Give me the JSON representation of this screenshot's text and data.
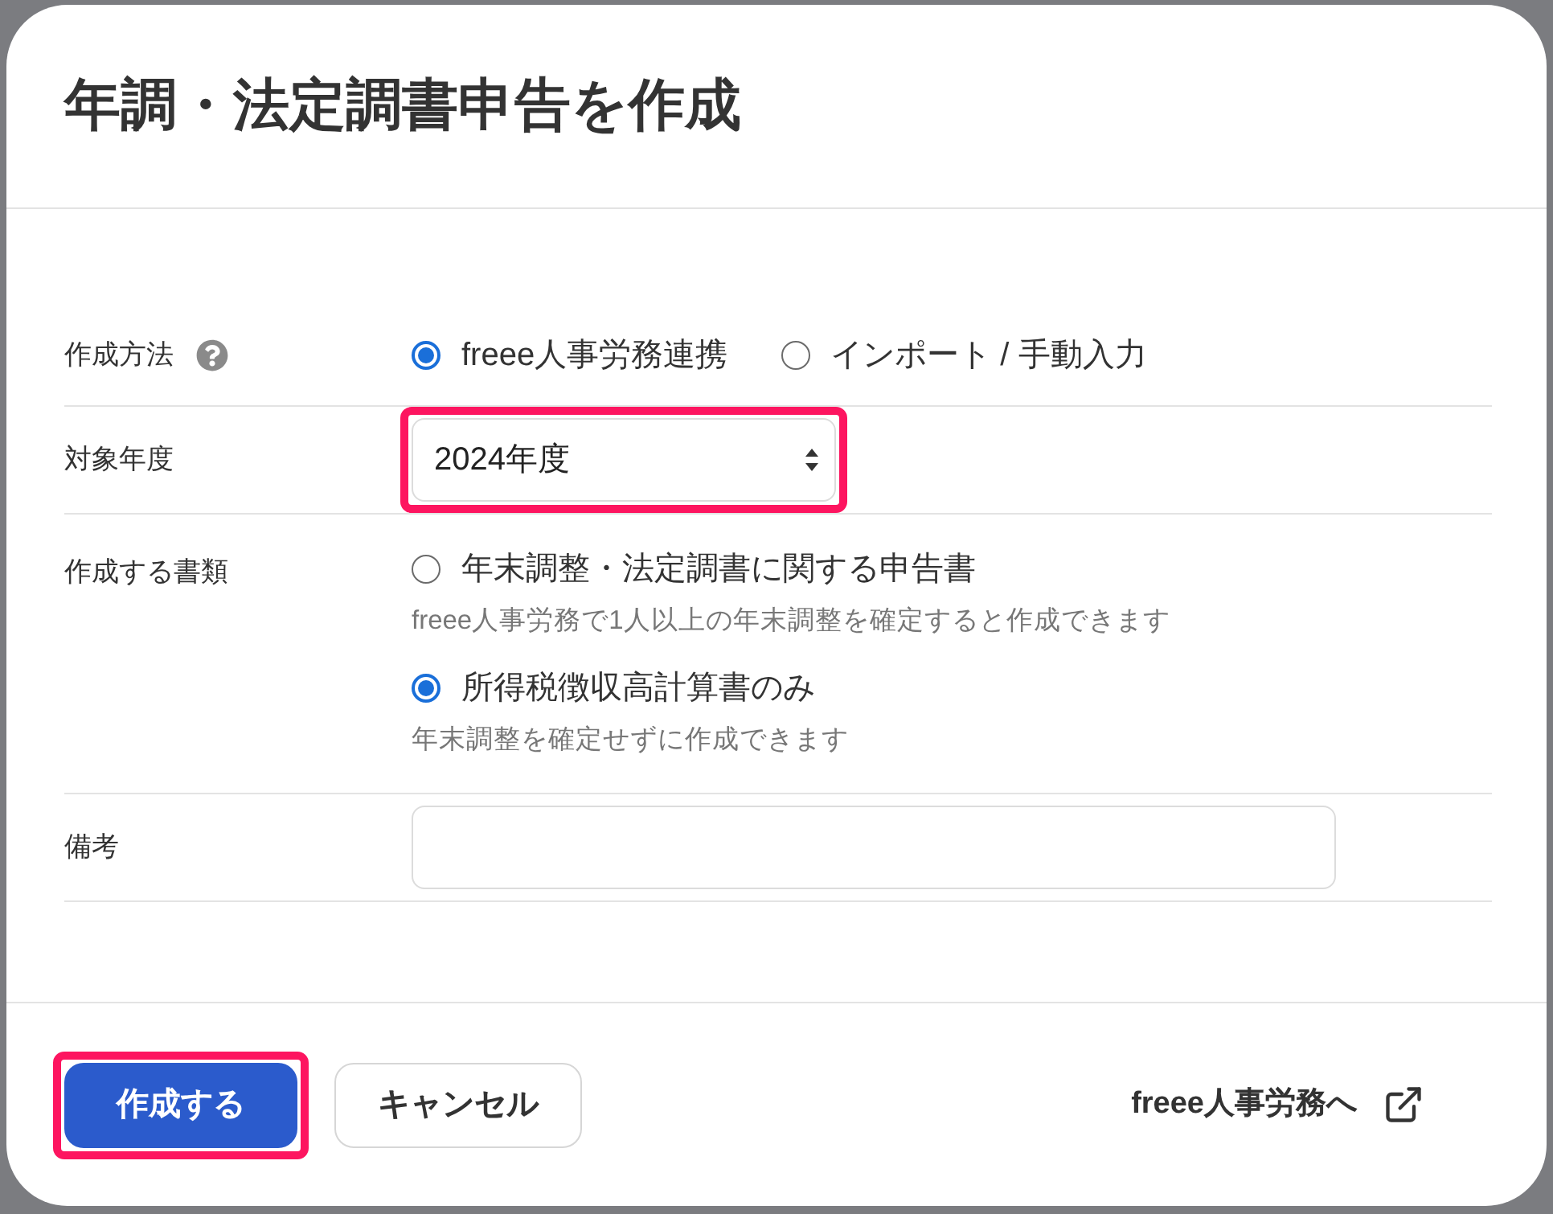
{
  "dialog": {
    "title": "年調・法定調書申告を作成",
    "fields": [
      {
        "kind": "radio_row",
        "label": "作成方法",
        "help": true,
        "options": [
          {
            "label": "freee人事労務連携",
            "selected": true
          },
          {
            "label": "インポート / 手動入力",
            "selected": false
          }
        ]
      },
      {
        "kind": "select",
        "label": "対象年度",
        "value": "2024年度",
        "highlighted": true
      },
      {
        "kind": "radio_list",
        "label": "作成する書類",
        "options": [
          {
            "label": "年末調整・法定調書に関する申告書",
            "note": "freee人事労務で1人以上の年末調整を確定すると作成できます",
            "selected": false
          },
          {
            "label": "所得税徴収高計算書のみ",
            "note": "年末調整を確定せずに作成できます",
            "selected": true
          }
        ]
      },
      {
        "kind": "text_input",
        "label": "備考"
      }
    ],
    "footer": {
      "buttons": [
        {
          "kind": "primary",
          "label": "作成する",
          "highlighted": true
        },
        {
          "kind": "secondary",
          "label": "キャンセル",
          "highlighted": false
        }
      ],
      "link": {
        "label": "freee人事労務へ"
      }
    }
  }
}
